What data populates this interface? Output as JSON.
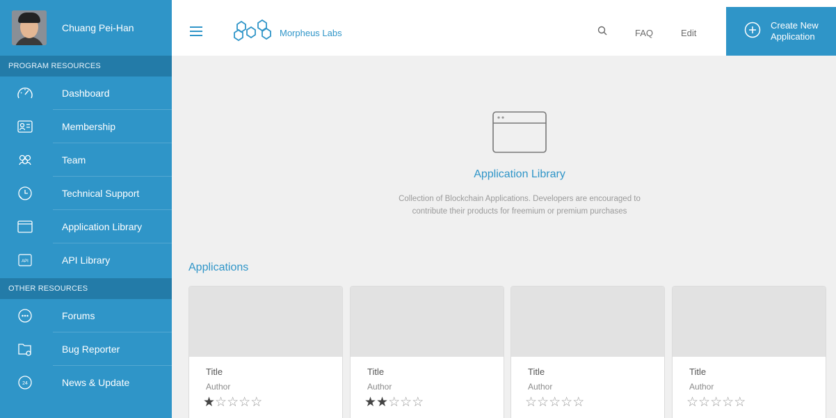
{
  "user": {
    "name": "Chuang Pei-Han"
  },
  "sidebar": {
    "program_header": "PROGRAM RESOURCES",
    "program_items": [
      {
        "label": "Dashboard",
        "icon": "speedometer-icon"
      },
      {
        "label": "Membership",
        "icon": "id-card-icon"
      },
      {
        "label": "Team",
        "icon": "team-icon"
      },
      {
        "label": "Technical Support",
        "icon": "clock-support-icon"
      },
      {
        "label": "Application Library",
        "icon": "browser-window-icon"
      },
      {
        "label": "API Library",
        "icon": "api-icon"
      }
    ],
    "other_header": "OTHER RESOURCES",
    "other_items": [
      {
        "label": "Forums",
        "icon": "chat-bubble-icon"
      },
      {
        "label": "Bug Reporter",
        "icon": "folder-bug-icon"
      },
      {
        "label": "News & Update",
        "icon": "news-clock-icon"
      }
    ]
  },
  "topbar": {
    "brand": "Morpheus Labs",
    "faq": "FAQ",
    "edit": "Edit",
    "create_button": "Create New Application"
  },
  "hero": {
    "title": "Application Library",
    "description": "Collection of Blockchain Applications. Developers are encouraged to contribute their products for freemium or premium purchases"
  },
  "applications": {
    "heading": "Applications",
    "cards": [
      {
        "title": "Title",
        "author": "Author",
        "rating": 1,
        "max_rating": 5
      },
      {
        "title": "Title",
        "author": "Author",
        "rating": 2,
        "max_rating": 5
      },
      {
        "title": "Title",
        "author": "Author",
        "rating": 0,
        "max_rating": 5
      },
      {
        "title": "Title",
        "author": "Author",
        "rating": 0,
        "max_rating": 5
      }
    ]
  },
  "colors": {
    "accent": "#2f95c8",
    "sidebar_section": "#237ba8"
  }
}
